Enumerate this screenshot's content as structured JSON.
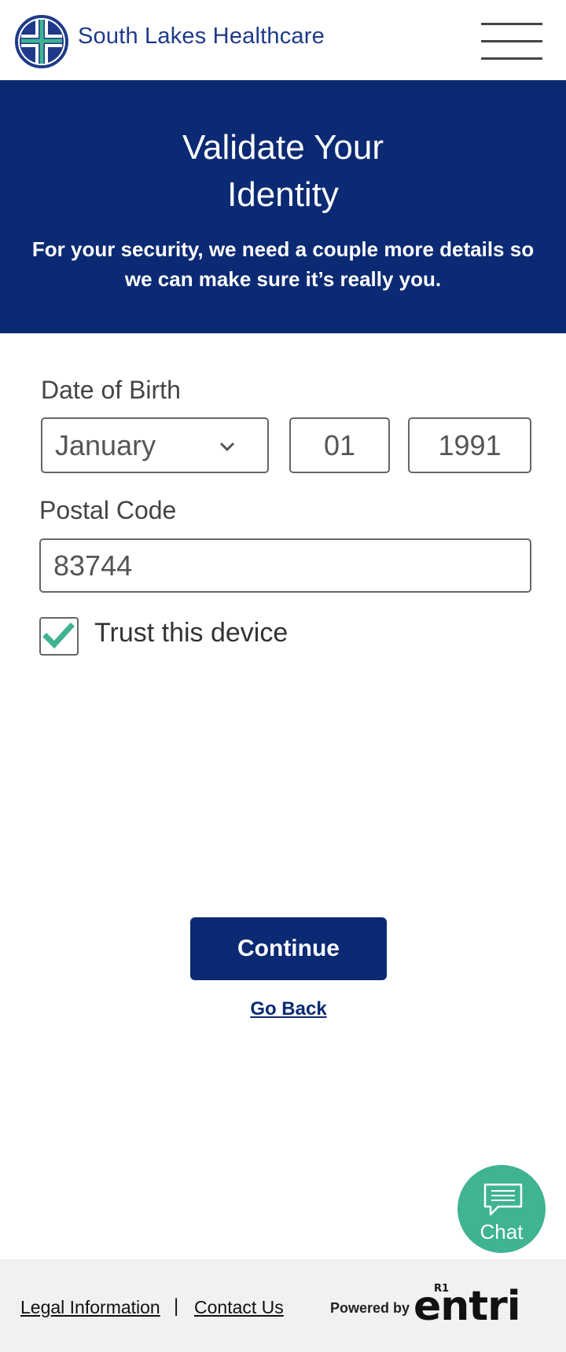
{
  "header": {
    "brand_name": "South Lakes Healthcare",
    "menu_icon": "hamburger-menu-icon",
    "logo_icon": "cross-shield-logo-icon"
  },
  "banner": {
    "title_line1": "Validate Your",
    "title_line2": "Identity",
    "subtitle": "For your security, we need a couple more details so we can make sure it’s really you."
  },
  "form": {
    "dob_label": "Date of Birth",
    "month_value": "January",
    "day_value": "01",
    "year_value": "1991",
    "postal_label": "Postal Code",
    "postal_value": "83744",
    "trust_label": "Trust this device",
    "trust_checked": true
  },
  "actions": {
    "continue_label": "Continue",
    "go_back_label": "Go Back"
  },
  "chat": {
    "label": "Chat",
    "icon": "chat-bubble-icon"
  },
  "footer": {
    "legal_link": "Legal Information",
    "separator": "|",
    "contact_link": "Contact Us",
    "powered_by": "Powered by",
    "logo_text": "entri",
    "logo_superscript": "R1"
  },
  "colors": {
    "brand_navy": "#0b2a73",
    "brand_text_blue": "#1f3a8a",
    "accent_teal": "#3fb392",
    "footer_bg": "#f1f1f1"
  }
}
